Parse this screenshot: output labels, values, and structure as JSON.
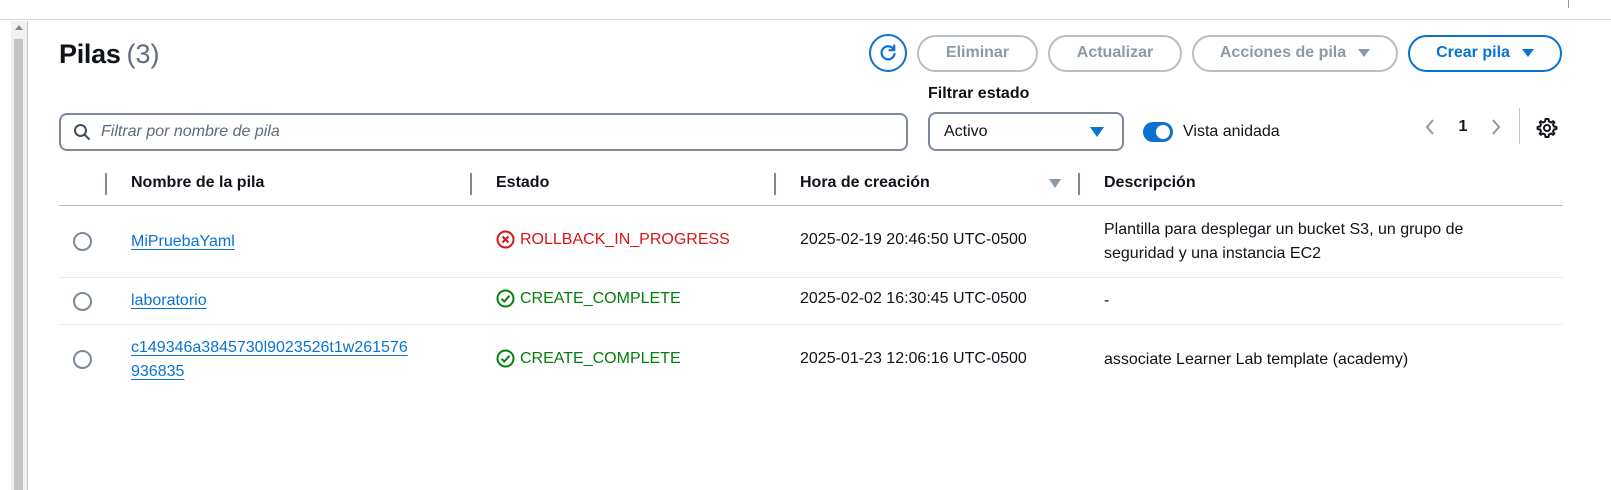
{
  "header": {
    "title": "Pilas",
    "count": "(3)"
  },
  "actions": {
    "refresh_icon": "refresh-icon",
    "delete_label": "Eliminar",
    "update_label": "Actualizar",
    "stack_actions_label": "Acciones de pila",
    "create_label": "Crear pila",
    "accent_color": "#0972d3",
    "disabled_color": "#8d99a8"
  },
  "search": {
    "placeholder": "Filtrar por nombre de pila",
    "value": ""
  },
  "filter": {
    "label": "Filtrar estado",
    "selected": "Activo"
  },
  "nested_view": {
    "label": "Vista anidada",
    "enabled": true
  },
  "pagination": {
    "current_page": "1"
  },
  "table": {
    "columns": [
      "Nombre de la pila",
      "Estado",
      "Hora de creación",
      "Descripción"
    ],
    "rows": [
      {
        "name": "MiPruebaYaml",
        "status": "ROLLBACK_IN_PROGRESS",
        "status_type": "error",
        "created": "2025-02-19 20:46:50 UTC-0500",
        "description_line1": "Plantilla para desplegar un bucket S3, un grupo de",
        "description_line2": "seguridad y una instancia EC2"
      },
      {
        "name": "laboratorio",
        "status": "CREATE_COMPLETE",
        "status_type": "success",
        "created": "2025-02-02 16:30:45 UTC-0500",
        "description_line1": "-"
      },
      {
        "name_line1": "c149346a3845730l9023526t1w261576",
        "name_line2": "936835",
        "status": "CREATE_COMPLETE",
        "status_type": "success",
        "created": "2025-01-23 12:06:16 UTC-0500",
        "description_line1": "associate Learner Lab template (academy)"
      }
    ],
    "error_color": "#d91515",
    "success_color": "#037f0c"
  }
}
